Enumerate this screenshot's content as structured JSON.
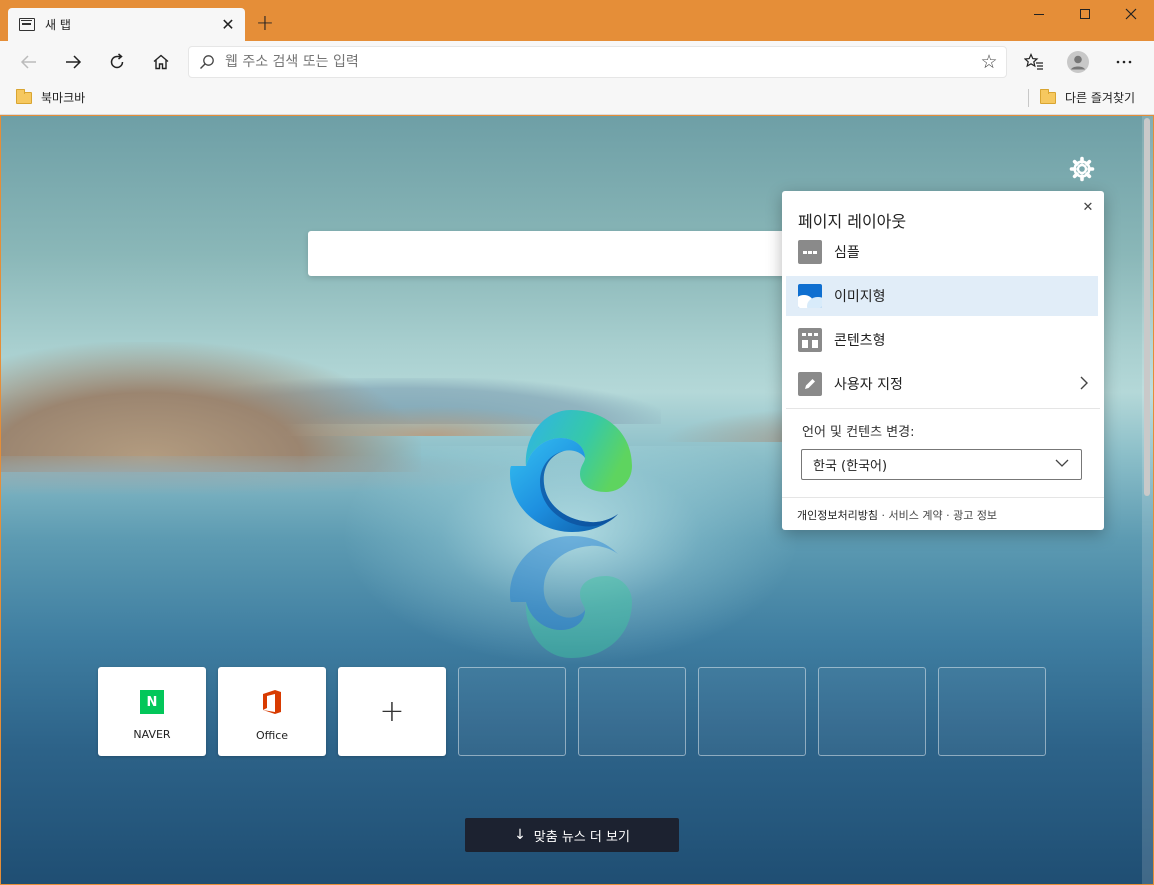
{
  "window": {
    "tab_title": "새 탭",
    "tab_close": "✕",
    "new_tab": "+"
  },
  "toolbar": {
    "address_placeholder": "웹 주소 검색 또는 입력"
  },
  "bookmarks": {
    "left_folder": "북마크바",
    "right_folder": "다른 즐겨찾기"
  },
  "tiles": [
    {
      "label": "NAVER",
      "icon": "naver-icon",
      "icon_letter": "N",
      "color": "#03c75a"
    },
    {
      "label": "Office",
      "icon": "office-icon",
      "color": "#d83b01"
    },
    {
      "label": "",
      "icon": "plus-icon"
    },
    {
      "label": "",
      "icon": ""
    },
    {
      "label": "",
      "icon": ""
    },
    {
      "label": "",
      "icon": ""
    },
    {
      "label": "",
      "icon": ""
    },
    {
      "label": "",
      "icon": ""
    }
  ],
  "tile_add_glyph": "+",
  "news_button": {
    "arrow": "↓",
    "label": "맞춤 뉴스 더 보기"
  },
  "layout_panel": {
    "title": "페이지 레이아웃",
    "close": "✕",
    "options": [
      {
        "label": "심플",
        "icon": "simple-layout-icon",
        "selected": false
      },
      {
        "label": "이미지형",
        "icon": "image-layout-icon",
        "selected": true
      },
      {
        "label": "콘텐츠형",
        "icon": "content-layout-icon",
        "selected": false
      },
      {
        "label": "사용자 지정",
        "icon": "custom-pencil-icon",
        "selected": false
      }
    ],
    "custom_chevron": "›",
    "language_label": "언어 및 컨텐츠 변경:",
    "language_value": "한국 (한국어)",
    "footer": {
      "privacy": "개인정보처리방침",
      "sep1": " · ",
      "terms": "서비스 계약",
      "sep2": " · ",
      "ads": "광고 정보"
    }
  },
  "colors": {
    "titlebar": "#e58e38",
    "selected_option": "#e1edf8",
    "news_button_bg": "#1c2230"
  }
}
